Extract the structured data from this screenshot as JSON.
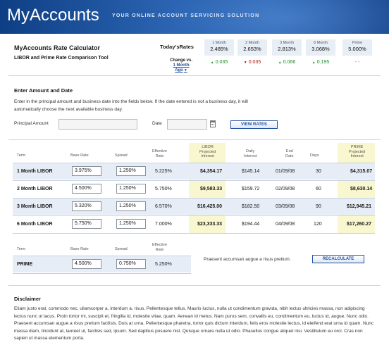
{
  "header": {
    "brand": "MyAccounts",
    "tagline": "YOUR ONLINE ACCOUNT SERVICING SOLUTION"
  },
  "calculator": {
    "title": "MyAccounts Rate Calculator",
    "subtitle": "LIBOR and Prime Rate Comparison Tool"
  },
  "todays_rates": {
    "label": "Today'sRates",
    "change_label": "Change vs.",
    "change_link": "1 Month Ago",
    "columns": [
      {
        "term": "1 Month",
        "value": "2.485%",
        "change": "0.035",
        "direction": "up"
      },
      {
        "term": "2 Month",
        "value": "2.653%",
        "change": "0.035",
        "direction": "down"
      },
      {
        "term": "3 Month",
        "value": "2.813%",
        "change": "0.066",
        "direction": "up"
      },
      {
        "term": "6 Month",
        "value": "3.068%",
        "change": "0.195",
        "direction": "up"
      },
      {
        "term": "Prime",
        "value": "5.000%",
        "change": "- -",
        "direction": "none"
      }
    ]
  },
  "enter": {
    "heading": "Enter Amount and Date",
    "instructions": "Enter in the principal amount and business date into the fields below.  If the date entered is not a business day, it will automatically choose the next available business day.",
    "principal_label": "Principal Amount",
    "principal_value": "",
    "date_label": "Date",
    "date_value": "",
    "view_button": "VIEW RATES"
  },
  "libor_table": {
    "headers": {
      "term": "Term",
      "base_rate": "Base Rate",
      "spread": "Spread",
      "effective": "Effective\nRate",
      "libor_interest": "LIBOR\nProjected\nInterest",
      "daily": "Daily\nInterest",
      "end_date": "End\nDate",
      "days": "Days",
      "prime_interest": "PRIME\nProjected\nInterest"
    },
    "rows": [
      {
        "term": "1 Month LIBOR",
        "base": "3.975%",
        "spread": "1.250%",
        "effective": "5.225%",
        "libor": "$4,354.17",
        "daily": "$145.14",
        "end": "01/09/08",
        "days": "30",
        "prime": "$4,315.07"
      },
      {
        "term": "2 Month LIBOR",
        "base": "4.500%",
        "spread": "1.250%",
        "effective": "5.750%",
        "libor": "$9,583.33",
        "daily": "$159.72",
        "end": "02/09/08",
        "days": "60",
        "prime": "$8,630.14"
      },
      {
        "term": "3 Month LIBOR",
        "base": "5.320%",
        "spread": "1.250%",
        "effective": "6.570%",
        "libor": "$16,425.00",
        "daily": "$182.50",
        "end": "03/09/08",
        "days": "90",
        "prime": "$12,945.21"
      },
      {
        "term": "6 Month LIBOR",
        "base": "5.750%",
        "spread": "1.250%",
        "effective": "7.000%",
        "libor": "$23,333.33",
        "daily": "$194.44",
        "end": "04/09/08",
        "days": "120",
        "prime": "$17,260.27"
      }
    ]
  },
  "prime_table": {
    "headers": {
      "term": "Term",
      "base_rate": "Base Rate",
      "spread": "Spread",
      "effective": "Effective\nRate"
    },
    "row": {
      "term": "PRIME",
      "base": "4.500%",
      "spread": "0.750%",
      "effective": "5.250%"
    },
    "note": "Praesent accumsan augue a risus pretium.",
    "recalc_button": "RECALCULATE"
  },
  "disclaimer": {
    "heading": "Disclaimer",
    "text": "Etiam justo erat, commodo nec, ullamcorper a, interdum a, risus. Pellentesque tellus. Mauris luctus, nulla ut condimentum gravida, nibh lectus ultricies massa, non adipiscing lectus nunc ut lacus. Proin tortor mi, suscipit et, fringilla id, molestie vitae, quam. Aenean id metus. Nam purus sem, convallis eu, condimentum eu, luctus id, augue. Nunc odio. Praesent accumsan augue a risus pretium facilisis. Duis at urna. Pellentesque pharetra, tortor quis dictum interdum, felis eros molestie lectus, id eleifend erat urna id quam. Nunc massa diam, tincidunt at, laoreet ut, facilisis sed, ipsum. Sed dapibus posuere nisl. Quisque ornare nulla ut odio. Phasellus congue aliquet nisi. Vestibulum eu orci. Cras non sapien ut massa elementum porta."
  },
  "colors": {
    "header_blue": "#2c65b3",
    "link_blue": "#1f4fa0",
    "up_green": "#1c8a2a",
    "down_red": "#b01414",
    "highlight_yellow": "#f8f7cf"
  }
}
